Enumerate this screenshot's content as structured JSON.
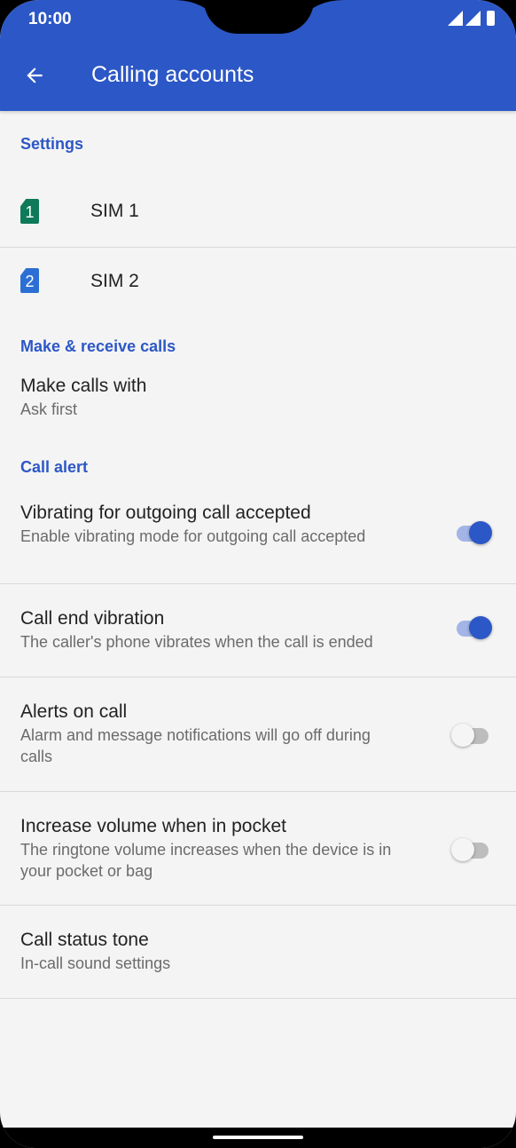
{
  "status_bar": {
    "time": "10:00"
  },
  "app_bar": {
    "title": "Calling accounts"
  },
  "sections": {
    "settings": "Settings",
    "make_receive": "Make & receive calls",
    "call_alert": "Call alert"
  },
  "sims": [
    {
      "number": "1",
      "label": "SIM 1",
      "color": "#0f7a5a"
    },
    {
      "number": "2",
      "label": "SIM 2",
      "color": "#2c6fd4"
    }
  ],
  "make_calls_with": {
    "title": "Make calls with",
    "value": "Ask first"
  },
  "call_alert_items": [
    {
      "title": "Vibrating for outgoing call accepted",
      "summary": "Enable vibrating mode for outgoing call accepted",
      "enabled": true
    },
    {
      "title": "Call end vibration",
      "summary": "The caller's phone vibrates when the call is ended",
      "enabled": true
    },
    {
      "title": "Alerts on call",
      "summary": "Alarm and message notifications will go off during calls",
      "enabled": false
    },
    {
      "title": "Increase volume when in pocket",
      "summary": "The ringtone volume increases when the device is in your pocket or bag",
      "enabled": false
    }
  ],
  "call_status_tone": {
    "title": "Call status tone",
    "summary": "In-call sound settings"
  },
  "colors": {
    "accent": "#2c57c6",
    "background": "#f4f4f4"
  }
}
